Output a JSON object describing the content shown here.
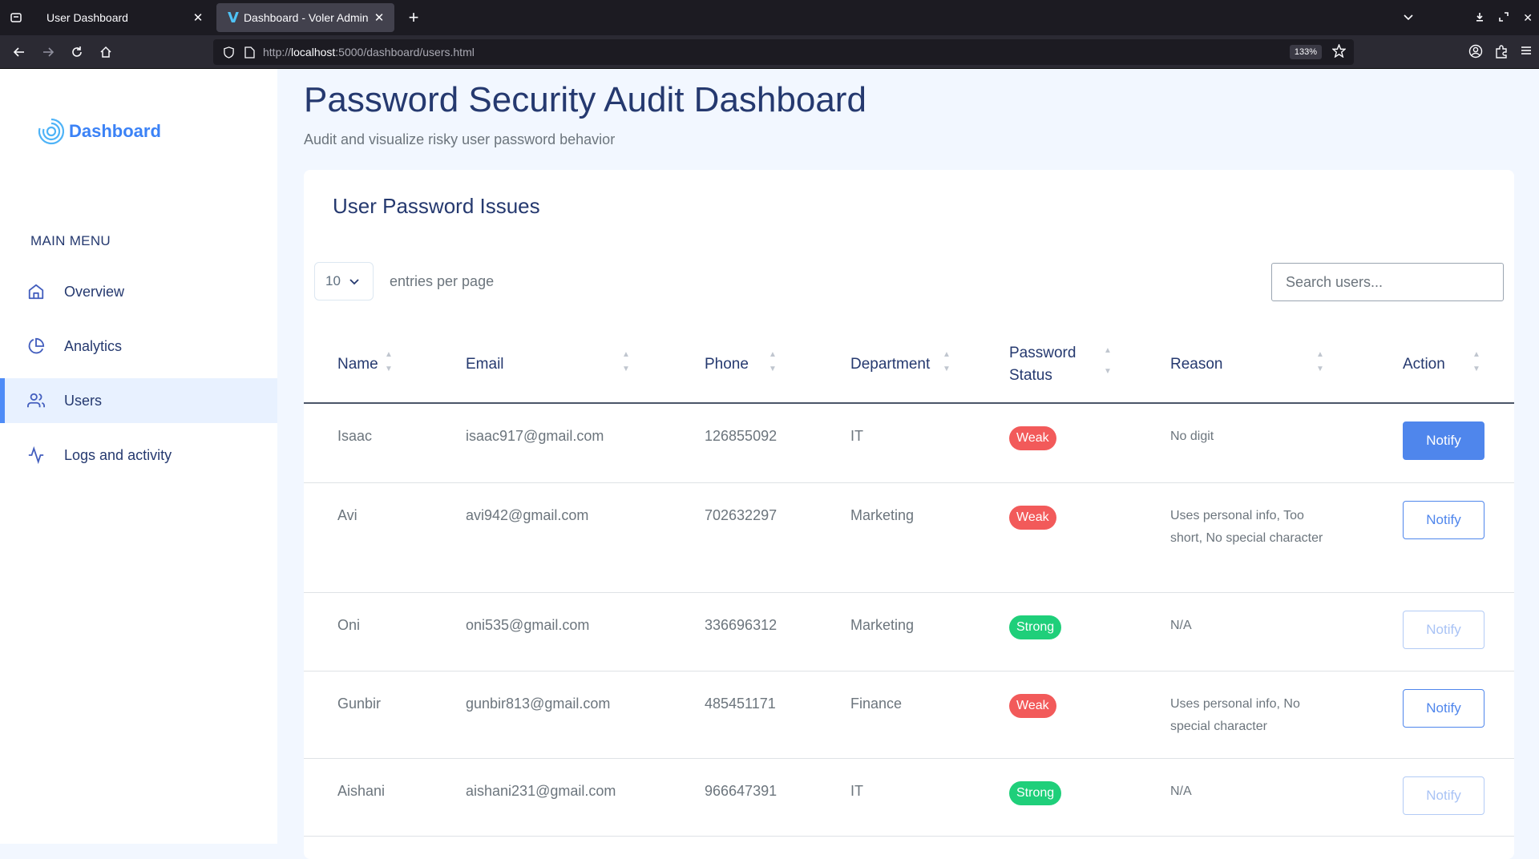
{
  "browser": {
    "tabs": [
      {
        "title": "User Dashboard",
        "active": false
      },
      {
        "title": "Dashboard - Voler Admin D",
        "active": true
      }
    ],
    "url_prefix": "http://",
    "url_host": "localhost",
    "url_rest": ":5000/dashboard/users.html",
    "zoom": "133%"
  },
  "sidebar": {
    "logo": "Dashboard",
    "menu_title": "MAIN MENU",
    "items": [
      {
        "label": "Overview",
        "icon": "home-icon",
        "active": false
      },
      {
        "label": "Analytics",
        "icon": "pie-chart-icon",
        "active": false
      },
      {
        "label": "Users",
        "icon": "users-icon",
        "active": true
      },
      {
        "label": "Logs and activity",
        "icon": "activity-icon",
        "active": false
      }
    ]
  },
  "page": {
    "title": "Password Security Audit Dashboard",
    "subtitle": "Audit and visualize risky user password behavior"
  },
  "card": {
    "title": "User Password Issues",
    "entries_value": "10",
    "entries_label": "entries per page",
    "search_placeholder": "Search users..."
  },
  "table": {
    "columns": [
      "Name",
      "Email",
      "Phone",
      "Department",
      "Password Status",
      "Reason",
      "Action"
    ],
    "rows": [
      {
        "name": "Isaac",
        "email": "isaac917@gmail.com",
        "phone": "126855092",
        "department": "IT",
        "status": "Weak",
        "reason": "No digit",
        "action": "Notify",
        "action_state": "primary"
      },
      {
        "name": "Avi",
        "email": "avi942@gmail.com",
        "phone": "702632297",
        "department": "Marketing",
        "status": "Weak",
        "reason": "Uses personal info, Too short, No special character",
        "action": "Notify",
        "action_state": "outline"
      },
      {
        "name": "Oni",
        "email": "oni535@gmail.com",
        "phone": "336696312",
        "department": "Marketing",
        "status": "Strong",
        "reason": "N/A",
        "action": "Notify",
        "action_state": "disabled"
      },
      {
        "name": "Gunbir",
        "email": "gunbir813@gmail.com",
        "phone": "485451171",
        "department": "Finance",
        "status": "Weak",
        "reason": "Uses personal info, No special character",
        "action": "Notify",
        "action_state": "outline"
      },
      {
        "name": "Aishani",
        "email": "aishani231@gmail.com",
        "phone": "966647391",
        "department": "IT",
        "status": "Strong",
        "reason": "N/A",
        "action": "Notify",
        "action_state": "disabled"
      }
    ]
  },
  "colors": {
    "accent": "#435ebe",
    "weak": "#f25a5a",
    "strong": "#1fcf7a",
    "button": "#4f86ec"
  }
}
